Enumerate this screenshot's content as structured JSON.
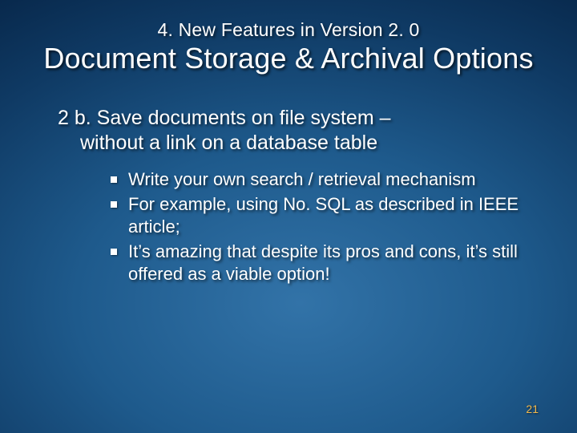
{
  "kicker": "4. New Features in Version 2. 0",
  "title": "Document Storage & Archival Options",
  "subhead_line1": "2 b. Save documents on file system –",
  "subhead_line2": "without a link on a database table",
  "bullets": [
    "Write your own search / retrieval mechanism",
    "For example, using No. SQL as described in IEEE article;",
    "It’s amazing that despite its pros and cons, it’s still offered as a viable option!"
  ],
  "page_number": "21"
}
